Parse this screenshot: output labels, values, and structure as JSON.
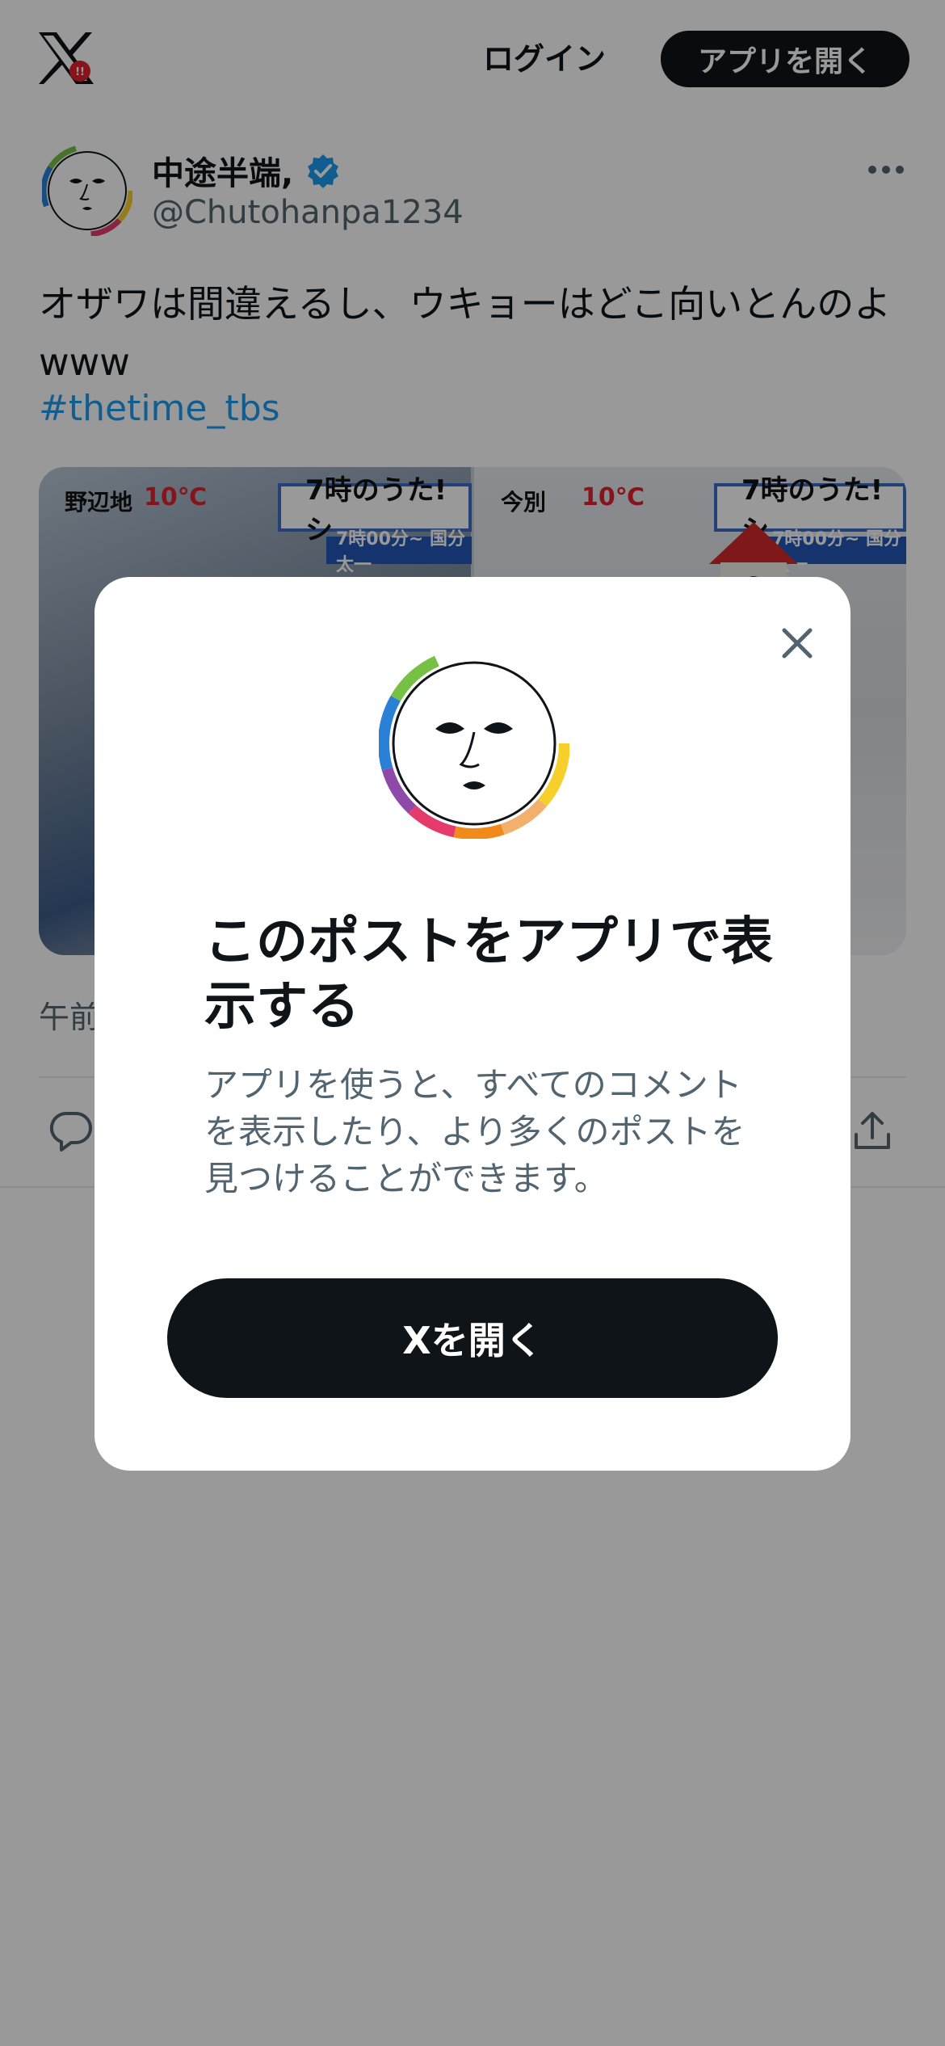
{
  "topbar": {
    "login": "ログイン",
    "open_app": "アプリを開く"
  },
  "tweet": {
    "author_name": "中途半端,",
    "author_handle": "@Chutohanpa1234",
    "text": "オザワは間違えるし、ウキョーはどこ向いとんのよwww",
    "hashtag": "#thetime_tbs",
    "timestamp": "午前",
    "media": {
      "left_location": "野辺地",
      "left_temp": "10℃",
      "right_location": "今別",
      "right_temp": "10℃",
      "caption": "7時のうた! シ",
      "sub_caption": "7時00分~ 国分太一"
    }
  },
  "modal": {
    "title": "このポストをアプリで表示する",
    "description": "アプリを使うと、すべてのコメントを表示したり、より多くのポストを見つけることができます。",
    "button": "Xを開く"
  },
  "colors": {
    "accent": "#1d9bf0",
    "dark": "#0f1419",
    "secondary_text": "#536471",
    "overlay": "rgba(0,0,0,0.4)"
  },
  "icons": [
    "x-logo-icon",
    "verified-icon",
    "more-icon",
    "reply-icon",
    "share-icon",
    "close-icon"
  ]
}
